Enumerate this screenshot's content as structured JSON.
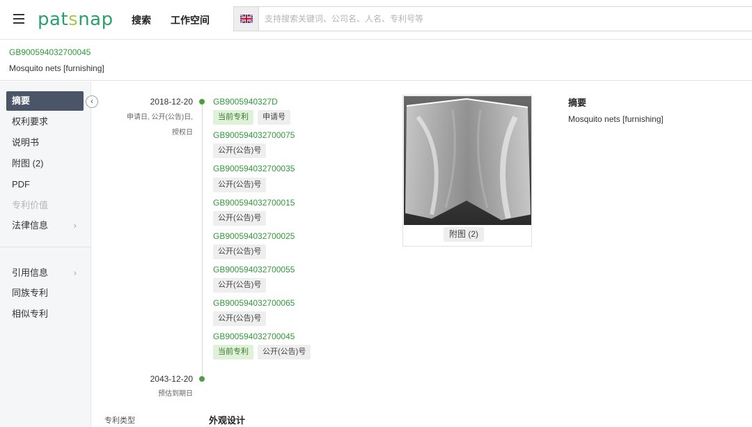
{
  "header": {
    "logo": "patsnap",
    "nav_search": "搜索",
    "nav_workspace": "工作空间",
    "search_placeholder": "支持搜索关键词、公司名、人名、专利号等",
    "flag_icon": "uk-flag-icon"
  },
  "patent": {
    "number": "GB900594032700045",
    "title": "Mosquito nets [furnishing]"
  },
  "sidebar": {
    "items": [
      {
        "label": "摘要",
        "active": true
      },
      {
        "label": "权利要求"
      },
      {
        "label": "说明书"
      },
      {
        "label": "附图 (2)"
      },
      {
        "label": "PDF"
      },
      {
        "label": "专利价值",
        "disabled": true
      },
      {
        "label": "法律信息",
        "arrow": "›"
      },
      {
        "label": "引用信息",
        "arrow": "›"
      },
      {
        "label": "同族专利"
      },
      {
        "label": "相似专利"
      }
    ],
    "collapse_icon": "‹"
  },
  "timeline": {
    "start_date": "2018-12-20",
    "start_desc_1": "申请日, 公开(公告)日,",
    "start_desc_2": "授权日",
    "end_date": "2043-12-20",
    "end_desc": "预估到期日",
    "entries": [
      {
        "number": "GB9005940327D",
        "tags": [
          "当前专利",
          "申请号"
        ]
      },
      {
        "number": "GB900594032700075",
        "tags": [
          "公开(公告)号"
        ]
      },
      {
        "number": "GB900594032700035",
        "tags": [
          "公开(公告)号"
        ]
      },
      {
        "number": "GB900594032700015",
        "tags": [
          "公开(公告)号"
        ]
      },
      {
        "number": "GB900594032700025",
        "tags": [
          "公开(公告)号"
        ]
      },
      {
        "number": "GB900594032700055",
        "tags": [
          "公开(公告)号"
        ]
      },
      {
        "number": "GB900594032700065",
        "tags": [
          "公开(公告)号"
        ]
      },
      {
        "number": "GB900594032700045",
        "tags": [
          "当前专利",
          "公开(公告)号"
        ]
      }
    ]
  },
  "figure": {
    "label": "附图 (2)"
  },
  "abstract": {
    "heading": "摘要",
    "text": "Mosquito nets [furnishing]"
  },
  "patent_type": {
    "label": "专利类型",
    "value": "外观设计"
  },
  "colors": {
    "brand_green": "#2aa06f",
    "link_green": "#2f9a3a",
    "active_nav": "#4a5568"
  }
}
